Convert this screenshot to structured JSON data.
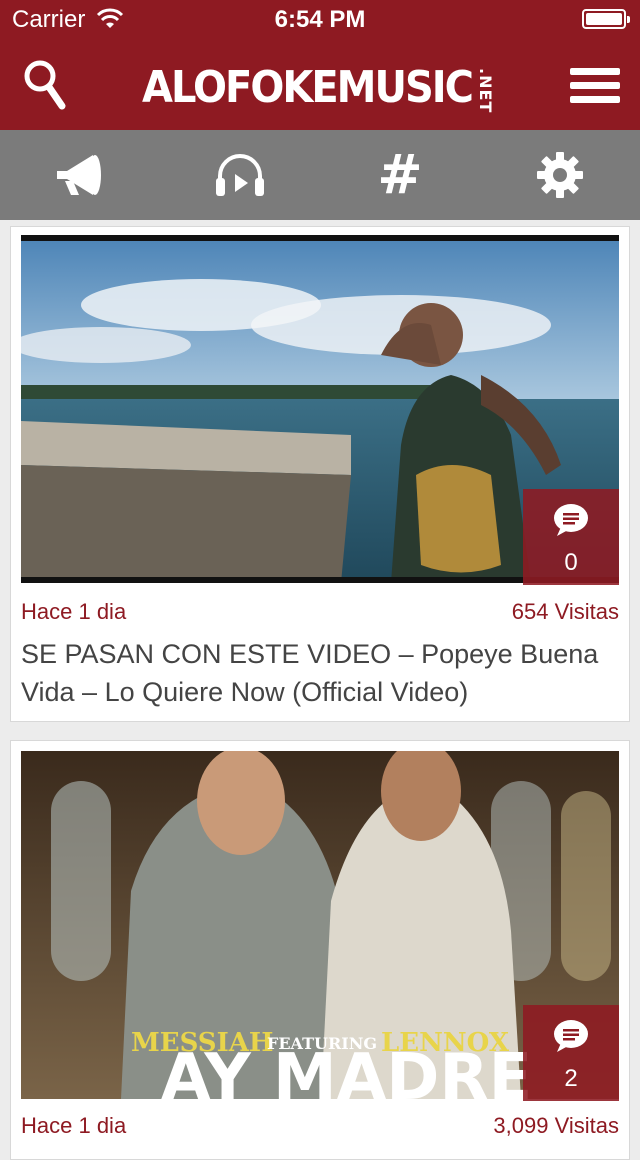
{
  "status_bar": {
    "carrier": "Carrier",
    "time": "6:54 PM"
  },
  "header": {
    "logo_main": "ALOFOKEMUSIC",
    "logo_tld": ".NET",
    "search_icon": "search-icon",
    "menu_icon": "hamburger-menu-icon"
  },
  "tabs": [
    {
      "icon": "megaphone-icon"
    },
    {
      "icon": "headphones-play-icon"
    },
    {
      "icon": "hashtag-icon",
      "glyph": "#"
    },
    {
      "icon": "gear-icon"
    }
  ],
  "posts": [
    {
      "date": "Hace 1 dia",
      "views": "654 Visitas",
      "title": "SE PASAN CON ESTE VIDEO – Popeye Buena Vida – Lo Quiere Now (Official Video)",
      "comments": "0",
      "thumbnail": "music-video-thumbnail"
    },
    {
      "date": "Hace 1 dia",
      "views": "3,099 Visitas",
      "comments": "2",
      "thumbnail": "album-cover-thumbnail",
      "artwork_text": {
        "artist1": "MESSIAH",
        "featuring": "FEATURING",
        "artist2": "LENNOX",
        "song": "AY MADRE"
      }
    }
  ],
  "colors": {
    "brand": "#8e1a22",
    "tab_bar": "#7b7b7b",
    "meta_text": "#8e1a22",
    "title_text": "#444444"
  }
}
